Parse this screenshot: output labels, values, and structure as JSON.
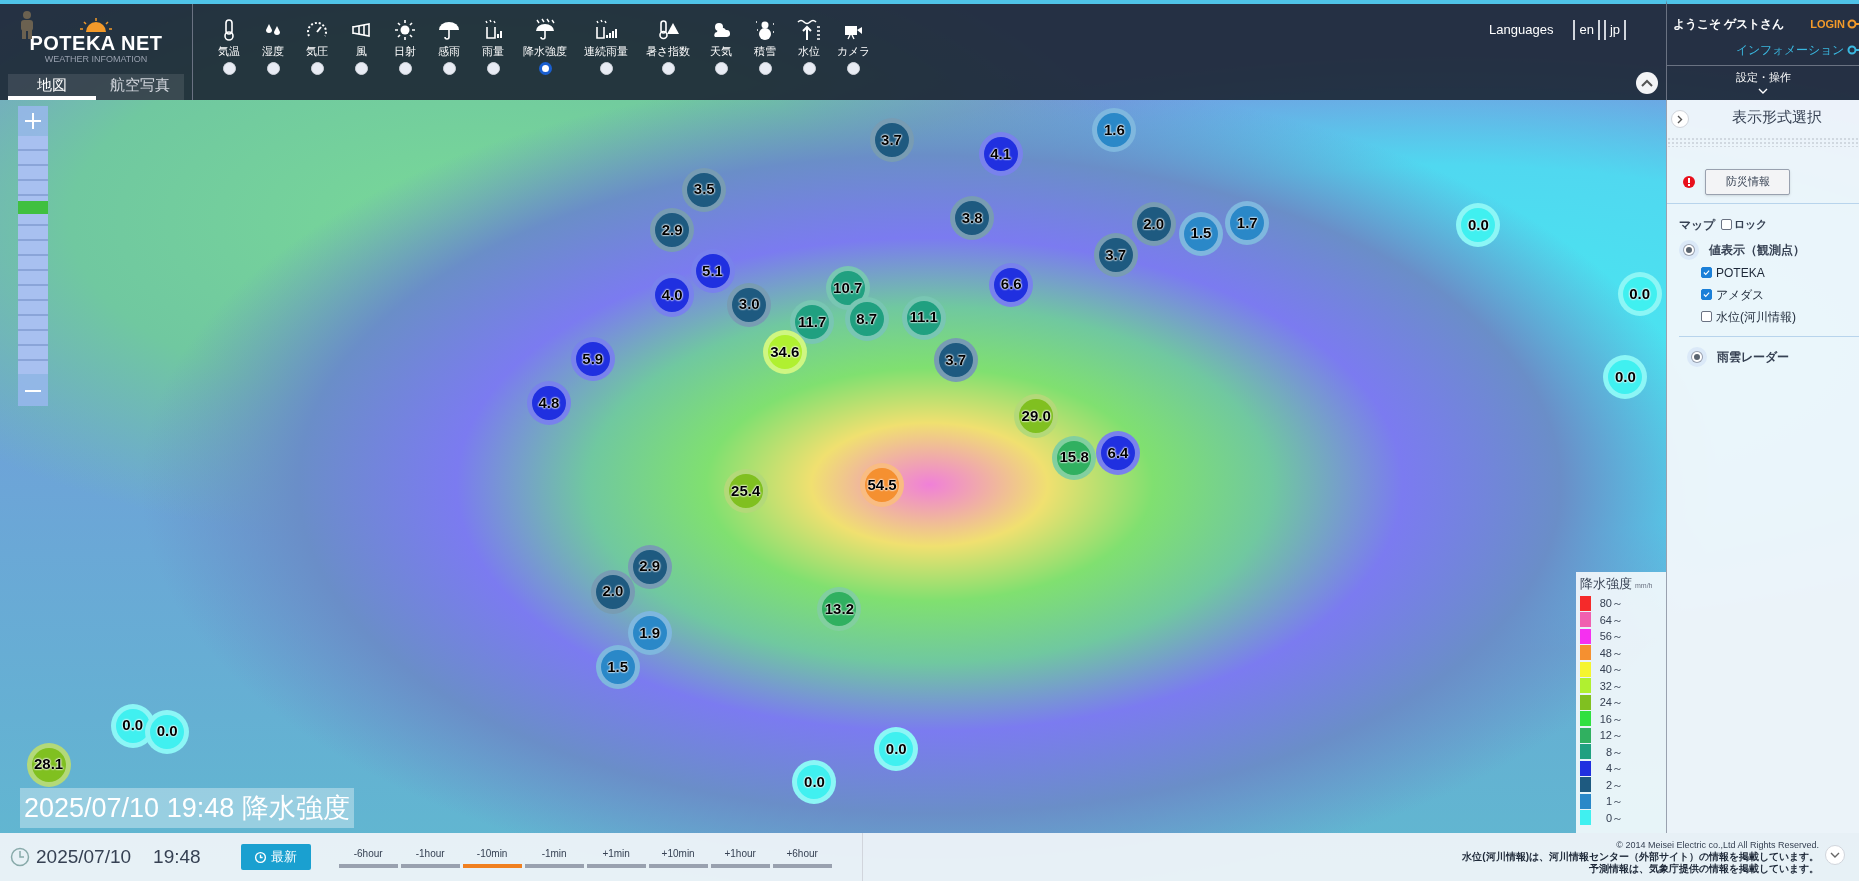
{
  "header": {
    "logo": "POTEKA NET",
    "tagline": "WEATHER INFOMATION",
    "map_tabs": [
      {
        "label": "地図",
        "selected": true
      },
      {
        "label": "航空写真",
        "selected": false
      }
    ],
    "layers": [
      {
        "label": "気温",
        "selected": false
      },
      {
        "label": "湿度",
        "selected": false
      },
      {
        "label": "気圧",
        "selected": false
      },
      {
        "label": "風",
        "selected": false
      },
      {
        "label": "日射",
        "selected": false
      },
      {
        "label": "感雨",
        "selected": false
      },
      {
        "label": "雨量",
        "selected": false
      },
      {
        "label": "降水強度",
        "selected": true
      },
      {
        "label": "連続雨量",
        "selected": false
      },
      {
        "label": "暑さ指数",
        "selected": false
      },
      {
        "label": "天気",
        "selected": false
      },
      {
        "label": "積雪",
        "selected": false
      },
      {
        "label": "水位",
        "selected": false
      },
      {
        "label": "カメラ",
        "selected": false
      }
    ],
    "languages_label": "Languages",
    "languages": [
      "en",
      "jp"
    ]
  },
  "user_panel": {
    "welcome": "ようこそ ゲストさん",
    "login": "LOGIN",
    "information": "インフォメーション",
    "settings": "設定・操作"
  },
  "display_panel": {
    "title": "表示形式選択",
    "disaster_button": "防災情報",
    "map_label": "マップ",
    "lock": {
      "label": "ロック",
      "checked": false
    },
    "options": [
      {
        "kind": "radio",
        "label": "値表示（観測点）",
        "selected": true
      },
      {
        "kind": "checkbox",
        "label": "POTEKA",
        "checked": true
      },
      {
        "kind": "checkbox",
        "label": "アメダス",
        "checked": true
      },
      {
        "kind": "checkbox",
        "label": "水位(河川情報)",
        "checked": false
      },
      {
        "kind": "radio",
        "label": "雨雲レーダー",
        "selected": true
      }
    ]
  },
  "zoom_slider": {
    "level": 0.7
  },
  "legend": {
    "title": "降水強度",
    "unit": "mm/h",
    "items": [
      {
        "label": "80～",
        "color": "#f52a2a"
      },
      {
        "label": "64～",
        "color": "#f060b0"
      },
      {
        "label": "56～",
        "color": "#f530f0"
      },
      {
        "label": "48～",
        "color": "#f59030"
      },
      {
        "label": "40～",
        "color": "#f5f530"
      },
      {
        "label": "32～",
        "color": "#b0f030"
      },
      {
        "label": "24～",
        "color": "#80c020"
      },
      {
        "label": "16～",
        "color": "#30e040"
      },
      {
        "label": "12～",
        "color": "#30b060"
      },
      {
        "label": "8～",
        "color": "#20a080"
      },
      {
        "label": "4～",
        "color": "#2030e0"
      },
      {
        "label": "2～",
        "color": "#1e5a80"
      },
      {
        "label": "1～",
        "color": "#2a88c8"
      },
      {
        "label": "0～",
        "color": "#40f0f0"
      }
    ]
  },
  "stations": [
    {
      "value": "1.6",
      "color": "#2a88c8"
    },
    {
      "value": "3.7",
      "color": "#1e5a80"
    },
    {
      "value": "4.1",
      "color": "#2030e0"
    },
    {
      "value": "3.5",
      "color": "#1e5a80"
    },
    {
      "value": "3.8",
      "color": "#1e5a80"
    },
    {
      "value": "2.9",
      "color": "#1e5a80"
    },
    {
      "value": "2.0",
      "color": "#1e5a80"
    },
    {
      "value": "1.5",
      "color": "#2a88c8"
    },
    {
      "value": "1.7",
      "color": "#2a88c8"
    },
    {
      "value": "0.0",
      "color": "#40f0f0"
    },
    {
      "value": "3.7",
      "color": "#1e5a80"
    },
    {
      "value": "5.1",
      "color": "#2030e0"
    },
    {
      "value": "6.6",
      "color": "#2030e0"
    },
    {
      "value": "4.0",
      "color": "#2030e0"
    },
    {
      "value": "3.0",
      "color": "#1e5a80"
    },
    {
      "value": "10.7",
      "color": "#20a080"
    },
    {
      "value": "11.7",
      "color": "#20a080"
    },
    {
      "value": "8.7",
      "color": "#20a080"
    },
    {
      "value": "11.1",
      "color": "#20a080"
    },
    {
      "value": "0.0",
      "color": "#40f0f0"
    },
    {
      "value": "34.6",
      "color": "#b0f030"
    },
    {
      "value": "5.9",
      "color": "#2030e0"
    },
    {
      "value": "3.7",
      "color": "#1e5a80"
    },
    {
      "value": "0.0",
      "color": "#40f0f0"
    },
    {
      "value": "4.8",
      "color": "#2030e0"
    },
    {
      "value": "29.0",
      "color": "#80c020"
    },
    {
      "value": "15.8",
      "color": "#30b060"
    },
    {
      "value": "6.4",
      "color": "#2030e0"
    },
    {
      "value": "54.5",
      "color": "#f59030"
    },
    {
      "value": "25.4",
      "color": "#80c020"
    },
    {
      "value": "2.9",
      "color": "#1e5a80"
    },
    {
      "value": "2.0",
      "color": "#1e5a80"
    },
    {
      "value": "13.2",
      "color": "#30b060"
    },
    {
      "value": "1.9",
      "color": "#2a88c8"
    },
    {
      "value": "1.5",
      "color": "#2a88c8"
    },
    {
      "value": "0.0",
      "color": "#40f0f0"
    },
    {
      "value": "0.0",
      "color": "#40f0f0"
    },
    {
      "value": "28.1",
      "color": "#80c020"
    },
    {
      "value": "0.0",
      "color": "#40f0f0"
    },
    {
      "value": "0.0",
      "color": "#40f0f0"
    }
  ],
  "map_caption": "2025/07/10 19:48 降水強度",
  "footer": {
    "date": "2025/07/10",
    "time": "19:48",
    "latest_button": "最新",
    "steps": [
      {
        "label": "-6hour",
        "selected": false
      },
      {
        "label": "-1hour",
        "selected": false
      },
      {
        "label": "-10min",
        "selected": true
      },
      {
        "label": "-1min",
        "selected": false
      },
      {
        "label": "+1min",
        "selected": false
      },
      {
        "label": "+10min",
        "selected": false
      },
      {
        "label": "+1hour",
        "selected": false
      },
      {
        "label": "+6hour",
        "selected": false
      }
    ],
    "copyright": "©  2014 Meisei Electric co.,Ltd All Rights Reserved.",
    "notes": [
      "水位(河川情報)は、河川情報センター（外部サイト）の情報を掲載しています。",
      "予測情報は、気象庁提供の情報を掲載しています。"
    ]
  }
}
